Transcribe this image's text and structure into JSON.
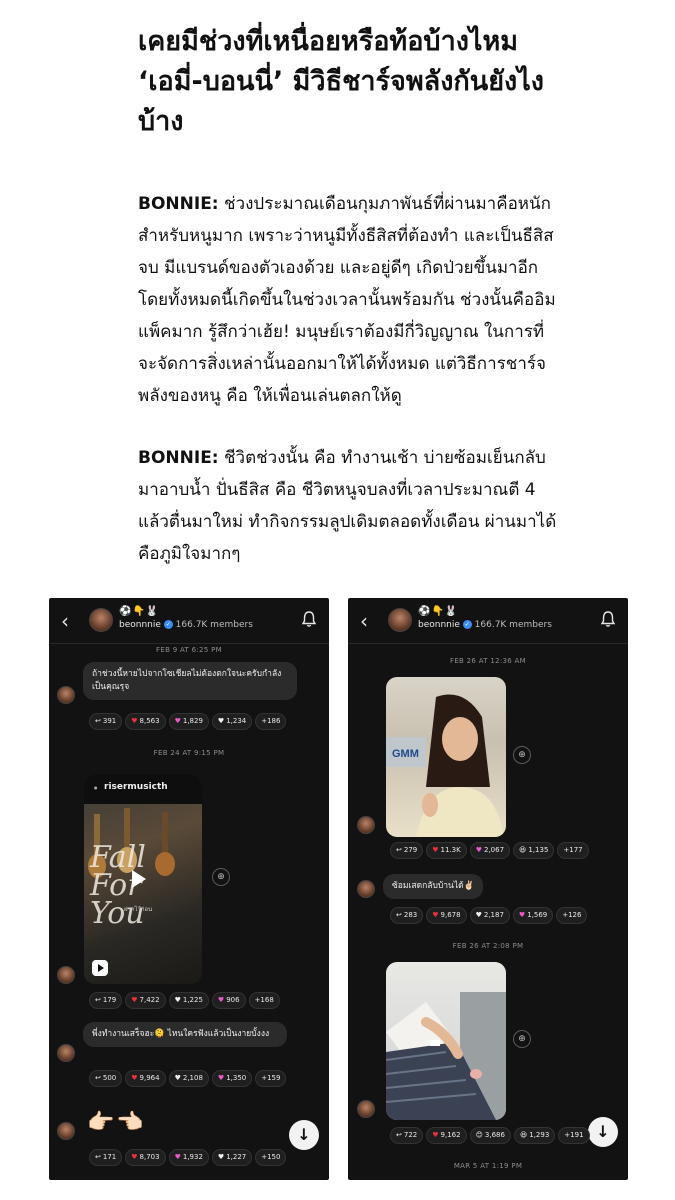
{
  "article": {
    "headline": "เคยมีช่วงที่เหนื่อยหรือท้อบ้างไหม ‘เอมี่-บอนนี่’ มีวิธีชาร์จพลังกันยังไงบ้าง",
    "para1": {
      "speaker": "BONNIE:",
      "text": " ช่วงประมาณเดือนกุมภาพันธ์ที่ผ่านมาคือหนักสำหรับหนูมาก เพราะว่าหนูมีทั้งธีสิสที่ต้องทำ และเป็นธีสิสจบ มีแบรนด์ของตัวเองด้วย และอยู่ดีๆ เกิดป่วยขึ้นมาอีก โดยทั้งหมดนี้เกิดขึ้นในช่วงเวลานั้นพร้อมกัน ช่วงนั้นคืออิมแพ็คมาก รู้สึกว่าเฮ้ย! มนุษย์เราต้องมีกี่วิญญาณ ในการที่จะจัดการสิ่งเหล่านั้นออกมาให้ได้ทั้งหมด แต่วิธีการชาร์จพลังของหนู คือ ให้เพื่อนเล่นตลกให้ดู"
    },
    "para2": {
      "speaker": "BONNIE:",
      "text": " ชีวิตช่วงนั้น คือ ทำงานเช้า บ่ายซ้อมเย็นกลับมาอาบน้ำ ปั่นธีสิส คือ ชีวิตหนูจบลงที่เวลาประมาณตี 4 แล้วตื่นมาใหม่ ทำกิจกรรมลูปเดิมตลอดทั้งเดือน ผ่านมาได้คือภูมิใจมากๆ"
    }
  },
  "channel": {
    "emojis": "⚽️👇🐰",
    "name": "beonnnie",
    "members": "166.7K members"
  },
  "left_phone": {
    "stamp1": "FEB 9 AT 6:25 PM",
    "msg1": "ถ้าช่วงนี้หายไปจากโซเชียลไม่ต้องตกใจนะครับกำลังเป็นคุณรุจ",
    "r1": [
      "391",
      "8,563",
      "1,829",
      "1,234",
      "+186"
    ],
    "stamp2": "FEB 24 AT 9:15 PM",
    "reel_handle": "risermusicth",
    "reel_title": "Fall For You",
    "reel_sub": "ฝากไว้ก่อน",
    "r2": [
      "179",
      "7,422",
      "1,225",
      "906",
      "+168"
    ],
    "msg3": "พี่งทำงานเสร็จฮะ🫠 ไหนใครฟังแล้วเป็นงายบั้งงง",
    "r3": [
      "500",
      "9,964",
      "2,108",
      "1,350",
      "+159"
    ],
    "emoji_msg": "👉🏻👈🏻",
    "r4": [
      "171",
      "8,703",
      "1,932",
      "1,227",
      "+150"
    ]
  },
  "right_phone": {
    "stamp1": "FEB 26 AT 12:36 AM",
    "r1": [
      "279",
      "11.3K",
      "2,067",
      "1,135",
      "+177"
    ],
    "msg2": "ซ้อมเสดกลับบ้านได้✌🏻",
    "r2": [
      "283",
      "9,678",
      "2,187",
      "1,569",
      "+126"
    ],
    "stamp2": "FEB 26 AT 2:08 PM",
    "r3": [
      "722",
      "9,162",
      "3,686",
      "1,293",
      "+191"
    ],
    "stamp3": "MAR 5 AT 1:19 PM"
  },
  "colors": {
    "phone_bg": "#121212",
    "bubble": "#2b2b2b",
    "heart_red": "#e8323c",
    "heart_pink": "#e85ac8",
    "heart_white": "#f2f2f2",
    "verified": "#3a8df5"
  }
}
